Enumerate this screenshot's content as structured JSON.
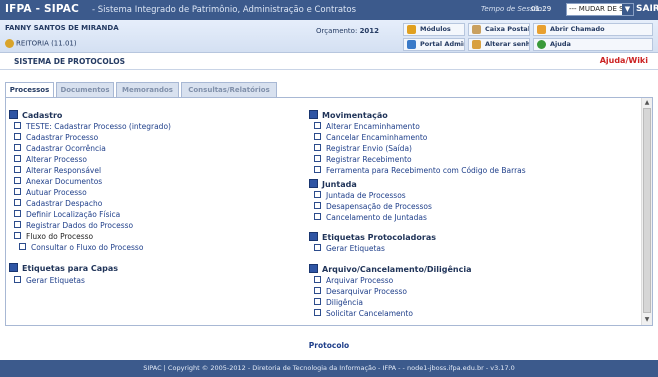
{
  "topbar": {
    "app_title": "IFPA - SIPAC",
    "subtitle": "- Sistema Integrado de Patrimônio, Administração e Contratos",
    "session_label": "Tempo de Sessão:",
    "session_time": "01:29",
    "system_select_value": "--- MUDAR DE SISTEMA ---",
    "logout_label": "SAIR"
  },
  "infobar": {
    "user_name": "FANNY SANTOS DE MIRANDA",
    "unit": "REITORIA (11.01)",
    "budget_label": "Orçamento:",
    "budget_year": "2012",
    "buttons": [
      {
        "label": "Módulos",
        "icon": "modules-icon",
        "color": "#e0a020"
      },
      {
        "label": "Caixa Postal",
        "icon": "mailbox-icon",
        "color": "#c9a060"
      },
      {
        "label": "Abrir Chamado",
        "icon": "ticket-icon",
        "color": "#e8a030"
      },
      {
        "label": "Portal Admin.",
        "icon": "portal-icon",
        "color": "#3a7ac8"
      },
      {
        "label": "Alterar senha",
        "icon": "password-icon",
        "color": "#d8a040"
      },
      {
        "label": "Ajuda",
        "icon": "help-icon",
        "color": "#3a9a3a"
      }
    ]
  },
  "system": {
    "name": "SISTEMA DE PROTOCOLOS",
    "help_link": "Ajuda/Wiki"
  },
  "tabs": [
    {
      "label": "Processos",
      "active": true
    },
    {
      "label": "Documentos",
      "active": false
    },
    {
      "label": "Memorandos",
      "active": false
    },
    {
      "label": "Consultas/Relatórios",
      "active": false
    }
  ],
  "left": {
    "cadastro_title": "Cadastro",
    "cadastro_items": [
      "TESTE: Cadastrar Processo (integrado)",
      "Cadastrar Processo",
      "Cadastrar Ocorrência",
      "Alterar Processo",
      "Alterar Responsável",
      "Anexar Documentos",
      "Autuar Processo",
      "Cadastrar Despacho",
      "Definir Localização Física",
      "Registrar Dados do Processo"
    ],
    "fluxo_label": "Fluxo do Processo",
    "fluxo_sub": "Consultar o Fluxo do Processo",
    "etiquetas_title": "Etiquetas para Capas",
    "etiquetas_items": [
      "Gerar Etiquetas"
    ]
  },
  "right": {
    "mov_title": "Movimentação",
    "mov_items": [
      "Alterar Encaminhamento",
      "Cancelar Encaminhamento",
      "Registrar Envio (Saída)",
      "Registrar Recebimento",
      "Ferramenta para Recebimento com Código de Barras"
    ],
    "juntada_title": "Juntada",
    "juntada_items": [
      "Juntada de Processos",
      "Desapensação de Processos",
      "Cancelamento de Juntadas"
    ],
    "etiq_prot_title": "Etiquetas Protocoladoras",
    "etiq_prot_items": [
      "Gerar Etiquetas"
    ],
    "arquivo_title": "Arquivo/Cancelamento/Diligência",
    "arquivo_items": [
      "Arquivar Processo",
      "Desarquivar Processo",
      "Diligência",
      "Solicitar Cancelamento"
    ]
  },
  "footer": {
    "module_link": "Protocolo",
    "copyright": "SIPAC | Copyright © 2005-2012 - Diretoria de Tecnologia da Informação - IFPA - - node1-jboss.ifpa.edu.br - v3.17.0"
  }
}
